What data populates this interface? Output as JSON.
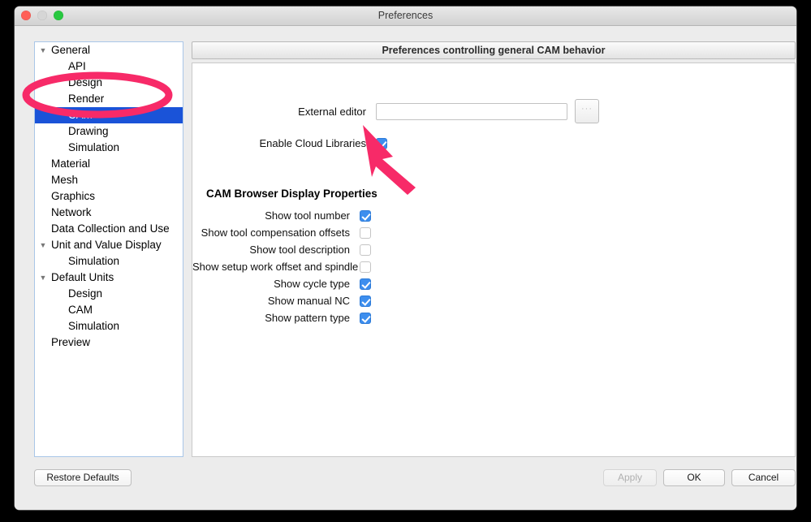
{
  "window": {
    "title": "Preferences",
    "traffic_lights": [
      "close-button",
      "minimize-button",
      "zoom-button"
    ]
  },
  "sidebar": {
    "items": [
      {
        "label": "General",
        "level": 0,
        "disclosure": "▼",
        "selected": false
      },
      {
        "label": "API",
        "level": 1,
        "disclosure": "",
        "selected": false
      },
      {
        "label": "Design",
        "level": 1,
        "disclosure": "",
        "selected": false
      },
      {
        "label": "Render",
        "level": 1,
        "disclosure": "",
        "selected": false
      },
      {
        "label": "CAM",
        "level": 1,
        "disclosure": "",
        "selected": true
      },
      {
        "label": "Drawing",
        "level": 1,
        "disclosure": "",
        "selected": false
      },
      {
        "label": "Simulation",
        "level": 1,
        "disclosure": "",
        "selected": false
      },
      {
        "label": "Material",
        "level": 0,
        "disclosure": "",
        "selected": false
      },
      {
        "label": "Mesh",
        "level": 0,
        "disclosure": "",
        "selected": false
      },
      {
        "label": "Graphics",
        "level": 0,
        "disclosure": "",
        "selected": false
      },
      {
        "label": "Network",
        "level": 0,
        "disclosure": "",
        "selected": false
      },
      {
        "label": "Data Collection and Use",
        "level": 0,
        "disclosure": "",
        "selected": false
      },
      {
        "label": "Unit and Value Display",
        "level": 0,
        "disclosure": "▼",
        "selected": false
      },
      {
        "label": "Simulation",
        "level": 1,
        "disclosure": "",
        "selected": false
      },
      {
        "label": "Default Units",
        "level": 0,
        "disclosure": "▼",
        "selected": false
      },
      {
        "label": "Design",
        "level": 1,
        "disclosure": "",
        "selected": false
      },
      {
        "label": "CAM",
        "level": 1,
        "disclosure": "",
        "selected": false
      },
      {
        "label": "Simulation",
        "level": 1,
        "disclosure": "",
        "selected": false
      },
      {
        "label": "Preview",
        "level": 0,
        "disclosure": "",
        "selected": false
      }
    ]
  },
  "panel": {
    "header": "Preferences controlling general CAM behavior",
    "external_editor": {
      "label": "External editor",
      "value": "",
      "placeholder": "",
      "browse_label": "···"
    },
    "enable_cloud_libraries": {
      "label": "Enable Cloud Libraries",
      "checked": true
    },
    "section_title": "CAM Browser Display Properties",
    "checkboxes": [
      {
        "label": "Show tool number",
        "checked": true
      },
      {
        "label": "Show tool compensation offsets",
        "checked": false
      },
      {
        "label": "Show tool description",
        "checked": false
      },
      {
        "label": "Show setup work offset and spindle",
        "checked": false
      },
      {
        "label": "Show cycle type",
        "checked": true
      },
      {
        "label": "Show manual NC",
        "checked": true
      },
      {
        "label": "Show pattern type",
        "checked": true
      }
    ]
  },
  "footer": {
    "restore_defaults": "Restore Defaults",
    "apply": "Apply",
    "apply_disabled": true,
    "ok": "OK",
    "cancel": "Cancel"
  },
  "annotations": {
    "highlight_color": "#F72A68",
    "ellipse_target": "sidebar-item-cam",
    "arrow_target": "enable-cloud-libraries-checkbox"
  },
  "colors": {
    "selection_blue": "#1A53D8",
    "checkbox_blue": "#3D8EEE",
    "annotation_pink": "#F72A68",
    "window_chrome": "#ECECEC",
    "tree_border": "#A9C6E8"
  }
}
